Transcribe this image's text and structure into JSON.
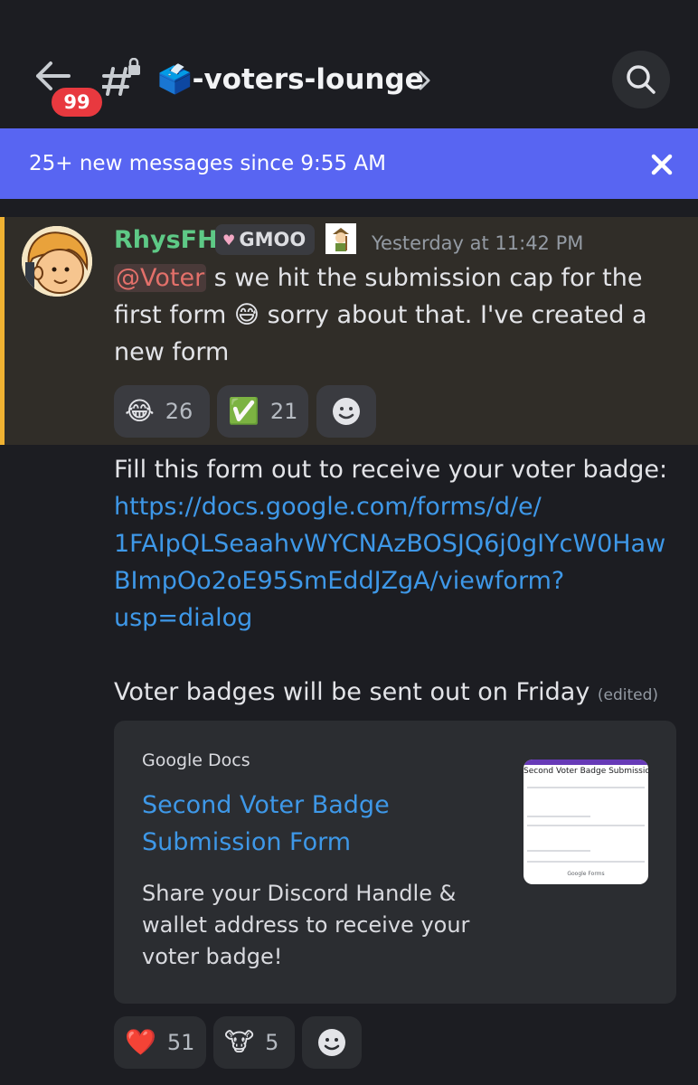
{
  "header": {
    "back_badge": "99",
    "channel_title": "🗳️-voters-lounge"
  },
  "new_messages_bar": {
    "text": "25+ new messages since 9:55 AM"
  },
  "message": {
    "author": "RhysFH",
    "tag": "GMOO",
    "timestamp": "Yesterday at 11:42 PM",
    "mention": "@Voter",
    "text_after_mention": " s we hit the submission cap for the first form 😅 sorry about that. I've created a new form",
    "reactions": [
      {
        "emoji": "😂",
        "count": "26"
      },
      {
        "emoji": "✅",
        "count": "21"
      }
    ],
    "body_line": "Fill this form out to receive your voter badge:",
    "link_lines": [
      "https://docs.google.com/forms/d/e/",
      "1FAIpQLSeaahvWYCNAzBOSJQ6j0gIYcW0Haw",
      "BImpOo2oE95SmEddJZgA/viewform?",
      "usp=dialog"
    ],
    "footer_line": "Voter badges will be sent out on Friday",
    "edited_label": "(edited)"
  },
  "embed": {
    "provider": "Google Docs",
    "title": "Second Voter Badge Submission Form",
    "description": "Share your Discord Handle & wallet address to receive your voter badge!",
    "thumbnail": {
      "title": "Second Voter Badge Submission Form",
      "footer": "Google Forms"
    }
  },
  "bottom_reactions": [
    {
      "emoji": "❤️",
      "count": "51"
    },
    {
      "emoji": "🐮",
      "count": "5"
    }
  ],
  "colors": {
    "background": "#1c1d22",
    "banner": "#5865f2",
    "highlight": "#302d28",
    "highlight_bar": "#f0b232",
    "username": "#5ec986",
    "link": "#3e98e8",
    "badge": "#e8393f"
  },
  "icons": [
    "back-arrow-icon",
    "channel-hash-lock-icon",
    "chevron-right-icon",
    "search-icon",
    "close-icon",
    "add-reaction-icon"
  ]
}
